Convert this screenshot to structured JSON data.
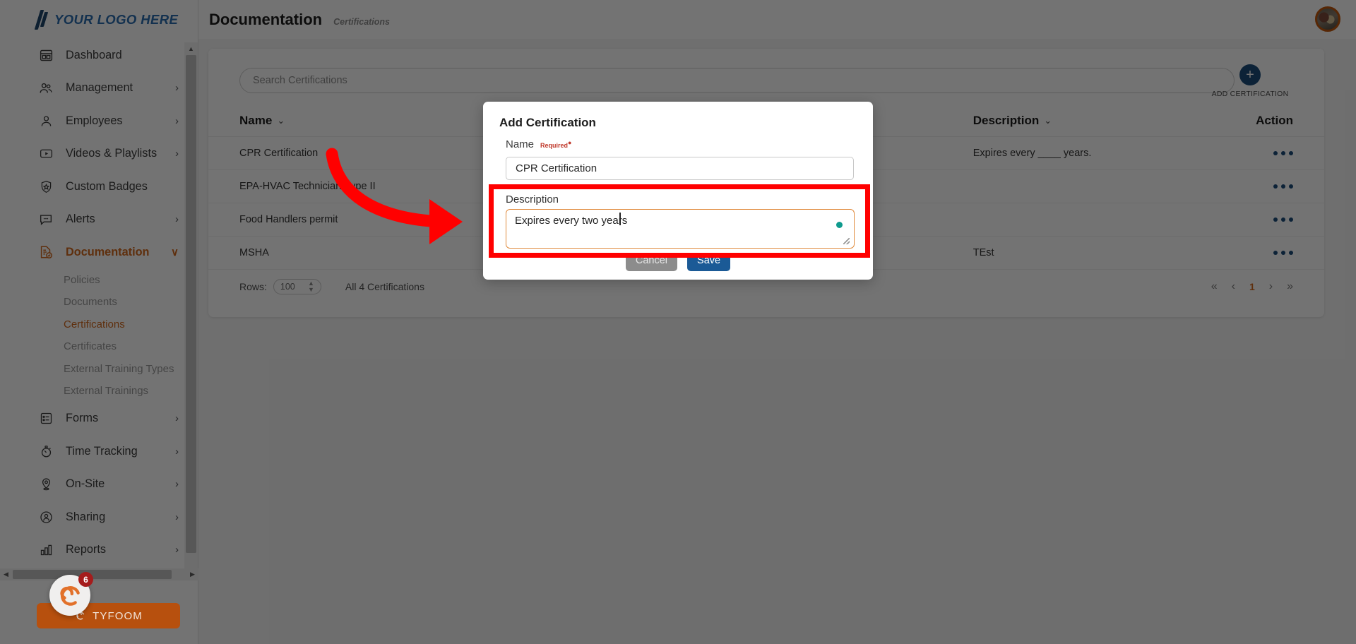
{
  "brand": {
    "logo_text": "YOUR LOGO HERE",
    "logo_icon": "slash-logo-icon",
    "accent_orange": "#d2691e",
    "accent_blue": "#1b4c7a",
    "logo_blue": "#2a6db0"
  },
  "header": {
    "title": "Documentation",
    "breadcrumb_sub": "Certifications",
    "avatar_name": "user-avatar"
  },
  "sidebar": {
    "items": [
      {
        "label": "Dashboard",
        "icon": "dashboard-icon",
        "chevron": "",
        "active": false
      },
      {
        "label": "Management",
        "icon": "people-icon",
        "chevron": "›",
        "active": false
      },
      {
        "label": "Employees",
        "icon": "person-icon",
        "chevron": "›",
        "active": false
      },
      {
        "label": "Videos & Playlists",
        "icon": "play-square-icon",
        "chevron": "›",
        "active": false
      },
      {
        "label": "Custom Badges",
        "icon": "badge-shield-icon",
        "chevron": "",
        "active": false
      },
      {
        "label": "Alerts",
        "icon": "chat-bubble-icon",
        "chevron": "›",
        "active": false
      },
      {
        "label": "Documentation",
        "icon": "document-check-icon",
        "chevron": "∨",
        "active": true
      }
    ],
    "sub_items": [
      {
        "label": "Policies",
        "active": false
      },
      {
        "label": "Documents",
        "active": false
      },
      {
        "label": "Certifications",
        "active": true
      },
      {
        "label": "Certificates",
        "active": false
      },
      {
        "label": "External Training Types",
        "active": false
      },
      {
        "label": "External Trainings",
        "active": false
      }
    ],
    "items_after": [
      {
        "label": "Forms",
        "icon": "form-list-icon",
        "chevron": "›"
      },
      {
        "label": "Time Tracking",
        "icon": "stopwatch-icon",
        "chevron": "›"
      },
      {
        "label": "On-Site",
        "icon": "map-pin-icon",
        "chevron": "›"
      },
      {
        "label": "Sharing",
        "icon": "share-person-icon",
        "chevron": "›"
      },
      {
        "label": "Reports",
        "icon": "bar-chart-icon",
        "chevron": "›"
      }
    ],
    "footer": {
      "tyfoom_label": "TYFOOM",
      "chat_badge_count": "6",
      "chat_icon": "tyfoom-spiral-icon"
    }
  },
  "toolbar": {
    "search_placeholder": "Search Certifications",
    "search_value": "",
    "add_button_label": "ADD CERTIFICATION",
    "add_button_icon": "plus-icon"
  },
  "table": {
    "columns": [
      {
        "label": "Name",
        "sortable": true
      },
      {
        "label": "Description",
        "sortable": true
      },
      {
        "label": "Action",
        "sortable": false
      }
    ],
    "rows": [
      {
        "name": "CPR Certification",
        "description": "Expires every ____ years."
      },
      {
        "name": "EPA-HVAC Technician-Type II",
        "description": ""
      },
      {
        "name": "Food Handlers permit",
        "description": ""
      },
      {
        "name": "MSHA",
        "description": "TEst"
      }
    ],
    "footer": {
      "rows_label": "Rows:",
      "rows_value": "100",
      "count_label": "All 4 Certifications",
      "pager": {
        "first": "«",
        "prev": "‹",
        "current": "1",
        "next": "›",
        "last": "»"
      }
    }
  },
  "modal": {
    "title": "Add Certification",
    "name_label": "Name",
    "required_label": "Required",
    "name_value": "CPR Certification",
    "description_label": "Description",
    "description_value": "Expires every two years",
    "cancel_label": "Cancel",
    "save_label": "Save",
    "highlight_color": "#ff0000",
    "focus_border_color": "#e08b3e",
    "indicator_color": "#0f9b8e"
  },
  "annotation": {
    "arrow_color": "#ff0000",
    "arrow_name": "pointer-arrow"
  }
}
